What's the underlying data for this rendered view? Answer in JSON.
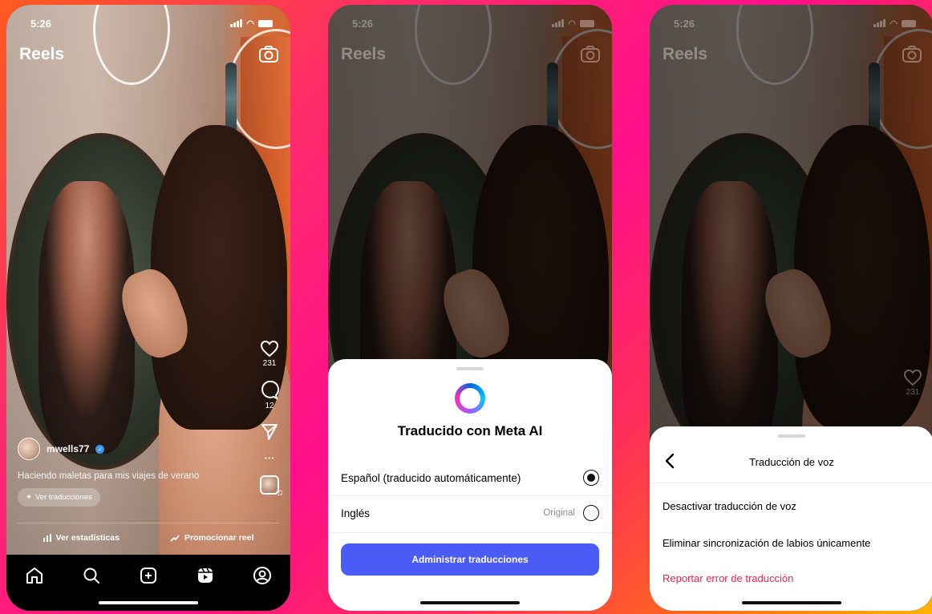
{
  "status": {
    "time": "5:26"
  },
  "header": {
    "title": "Reels"
  },
  "icons": {
    "camera": "camera-icon",
    "heart": "heart-icon",
    "comment": "comment-icon",
    "send": "send-icon",
    "more": "more-icon",
    "home": "home-icon",
    "search": "search-icon",
    "create": "create-icon",
    "reels": "reels-icon",
    "profile": "profile-icon",
    "back": "chevron-left-icon"
  },
  "actions": {
    "likes": "231",
    "comments": "12",
    "more": "···"
  },
  "post": {
    "username": "mwells77",
    "caption": "Haciendo maletas para mis viajes de verano",
    "translations_chip": "Ver traducciones"
  },
  "stats_bar": {
    "insights": "Ver estadísticas",
    "promote": "Promocionar reel"
  },
  "sheet_translate": {
    "title": "Traducido con Meta AI",
    "options": [
      {
        "label": "Español (traducido automáticamente)",
        "tag": "",
        "selected": true
      },
      {
        "label": "Inglés",
        "tag": "Original",
        "selected": false
      }
    ],
    "button": "Administrar traducciones"
  },
  "sheet_voice": {
    "title": "Traducción de voz",
    "items": [
      "Desactivar traducción de voz",
      "Eliminar sincronización de labios únicamente",
      "Reportar error de traducción"
    ]
  },
  "colors": {
    "primary_button": "#4a5cf5",
    "danger": "#f0244a",
    "verified": "#3897f0"
  }
}
